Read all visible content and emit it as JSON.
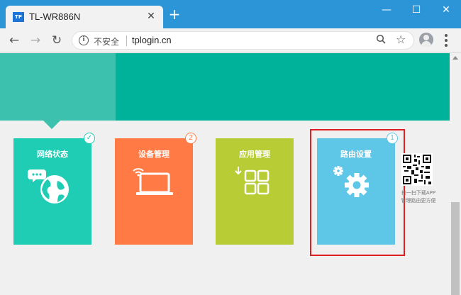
{
  "browser": {
    "tab_title": "TL-WR886N",
    "favicon_text": "TP",
    "tab_close": "✕",
    "new_tab": "+",
    "window_controls": {
      "minimize": "—",
      "maximize": "☐",
      "close": "✕"
    },
    "nav": {
      "back": "←",
      "forward": "→",
      "reload": "↻"
    },
    "security_label": "不安全",
    "url": "tplogin.cn",
    "icons": [
      "info-icon",
      "zoom-icon",
      "star-icon",
      "avatar-icon",
      "menu-icon"
    ]
  },
  "colors": {
    "titlebar": "#2b95d8",
    "banner": "#00b29a",
    "banner_active": "#3cc1ae",
    "network_status": "#1fcdb4",
    "device_management": "#ff7a44",
    "app_management": "#b7cc35",
    "router_settings": "#5ec6e7",
    "highlight": "#e02020"
  },
  "cards": [
    {
      "title": "网络状态",
      "icon": "globe-chat-icon",
      "badge": "✓",
      "badge_icon": "check-icon"
    },
    {
      "title": "设备管理",
      "icon": "laptop-wifi-icon",
      "badge": "2"
    },
    {
      "title": "应用管理",
      "icon": "apps-grid-icon"
    },
    {
      "title": "路由设置",
      "icon": "gear-icon",
      "badge": "1"
    }
  ],
  "qr": {
    "caption_line1": "扫一扫下载APP",
    "caption_line2": "管理路由更方便"
  }
}
